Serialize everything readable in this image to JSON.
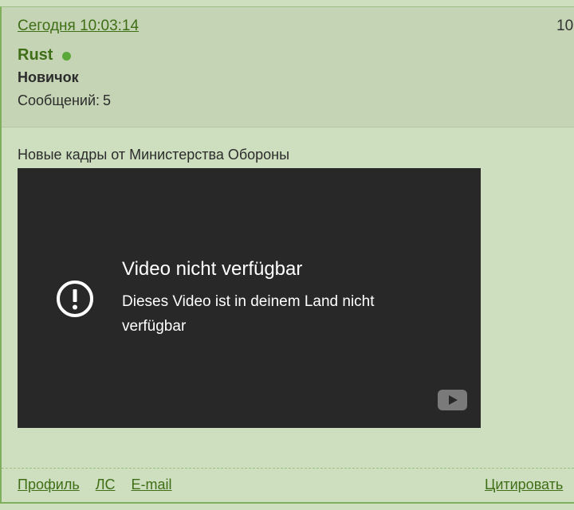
{
  "post": {
    "timestamp": "Сегодня 10:03:14",
    "number": "10",
    "author": {
      "name": "Rust",
      "status": "online",
      "rank": "Новичок",
      "messages_label": "Сообщений:",
      "messages_count": "5"
    },
    "text": "Новые кадры от Министерства Обороны",
    "video": {
      "title": "Video nicht verfügbar",
      "message": "Dieses Video ist in deinem Land nicht verfügbar",
      "icon": "alert-circle-icon",
      "logo": "youtube-icon"
    },
    "footer": {
      "links": [
        "Профиль",
        "ЛС",
        "E-mail"
      ],
      "quote": "Цитировать"
    }
  },
  "colors": {
    "background": "#cddfbf",
    "header_background": "#c4d4b4",
    "link": "#3f6e16",
    "online": "#5aa838",
    "video_background": "#282828"
  }
}
